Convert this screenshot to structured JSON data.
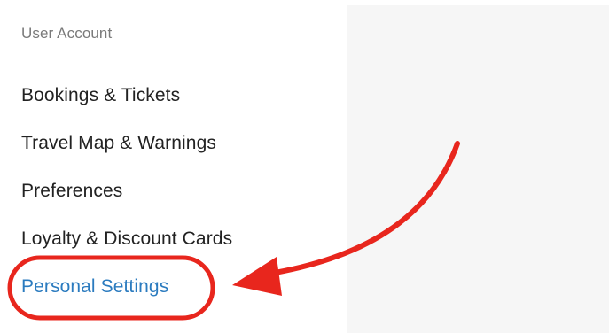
{
  "sidebar": {
    "heading": "User Account",
    "items": [
      {
        "label": "Bookings & Tickets"
      },
      {
        "label": "Travel Map & Warnings"
      },
      {
        "label": "Preferences"
      },
      {
        "label": "Loyalty & Discount Cards"
      },
      {
        "label": "Personal Settings",
        "active": true
      }
    ]
  },
  "colors": {
    "active_link": "#2b7bbf",
    "annotation": "#e8261d",
    "content_panel_bg": "#f6f6f6"
  },
  "annotation": {
    "type": "red-arrow-and-circle",
    "target": "Personal Settings"
  }
}
